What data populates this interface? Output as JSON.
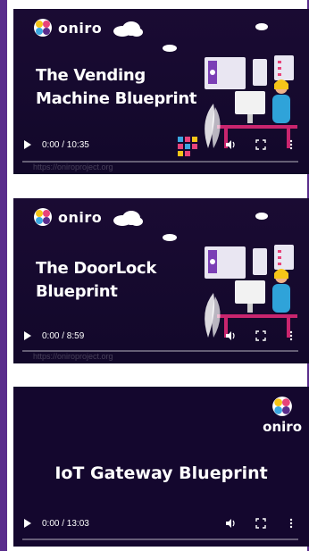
{
  "brand": {
    "logo_text": "oniro"
  },
  "videos": [
    {
      "title_line1": "The Vending",
      "title_line2": "Machine Blueprint",
      "time": "0:00 / 10:35",
      "url": "https://oniroproject.org"
    },
    {
      "title_line1": "The DoorLock",
      "title_line2": "Blueprint",
      "time": "0:00 / 8:59",
      "url": "https://oniroproject.org"
    },
    {
      "title": "IoT Gateway Blueprint",
      "time": "0:00 / 13:03"
    }
  ],
  "colors": {
    "accent_purple": "#5a2d8c",
    "video_bg": "#14072e",
    "logo_yellow": "#f5c518",
    "logo_pink": "#e8437a",
    "logo_blue": "#3aa7e0"
  },
  "icons": [
    "play-icon",
    "volume-icon",
    "fullscreen-icon",
    "more-options-icon",
    "cloud-icon",
    "oniro-logo-icon"
  ]
}
